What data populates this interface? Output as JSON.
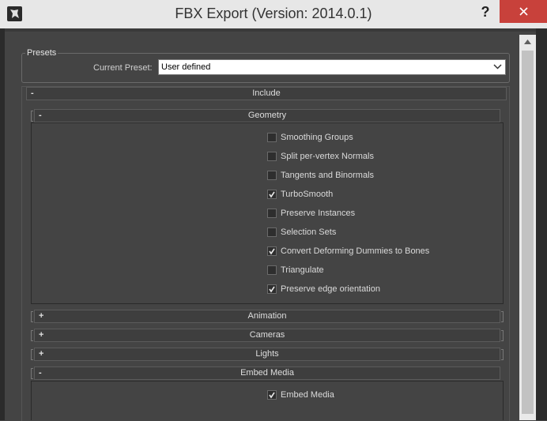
{
  "window": {
    "title": "FBX Export (Version: 2014.0.1)",
    "help_glyph": "?"
  },
  "presets": {
    "group_label": "Presets",
    "current_label": "Current Preset:",
    "current_value": "User defined"
  },
  "include": {
    "label": "Include",
    "toggle": "-"
  },
  "geometry": {
    "label": "Geometry",
    "toggle": "-",
    "options": [
      {
        "label": "Smoothing Groups",
        "checked": false
      },
      {
        "label": "Split per-vertex Normals",
        "checked": false
      },
      {
        "label": "Tangents and Binormals",
        "checked": false
      },
      {
        "label": "TurboSmooth",
        "checked": true
      },
      {
        "label": "Preserve Instances",
        "checked": false
      },
      {
        "label": "Selection Sets",
        "checked": false
      },
      {
        "label": "Convert Deforming Dummies to Bones",
        "checked": true
      },
      {
        "label": "Triangulate",
        "checked": false
      },
      {
        "label": "Preserve edge orientation",
        "checked": true
      }
    ]
  },
  "animation": {
    "label": "Animation",
    "toggle": "+"
  },
  "cameras": {
    "label": "Cameras",
    "toggle": "+"
  },
  "lights": {
    "label": "Lights",
    "toggle": "+"
  },
  "embed_media": {
    "label": "Embed Media",
    "toggle": "-",
    "options": [
      {
        "label": "Embed Media",
        "checked": true
      }
    ]
  }
}
